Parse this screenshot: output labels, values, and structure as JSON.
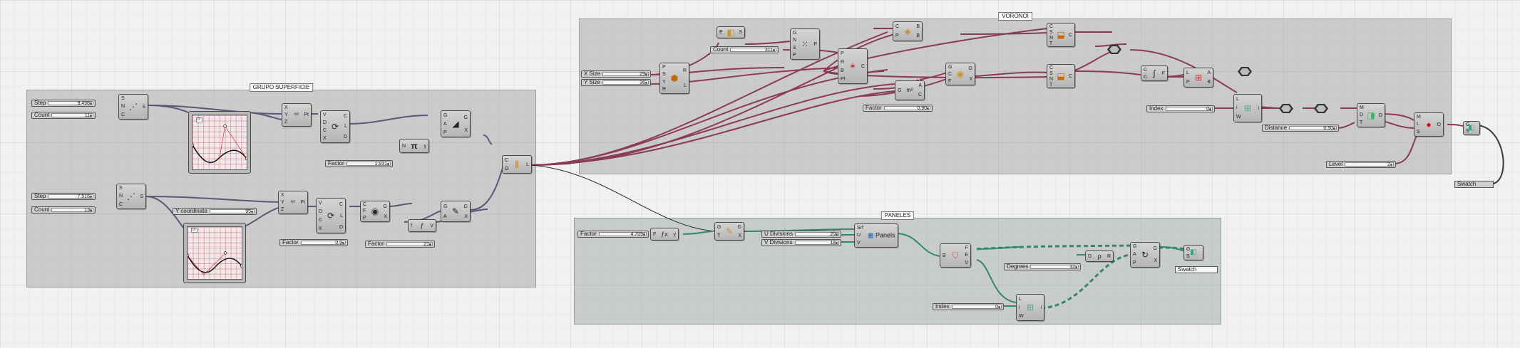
{
  "groups": {
    "superficie": "GRUPO SUPERFICIE",
    "voronoi": "VORONOI",
    "paneles": "PANELES"
  },
  "sliders": {
    "step1": {
      "label": "Step",
      "value": "9.498"
    },
    "count1": {
      "label": "Count",
      "value": "11"
    },
    "step2": {
      "label": "Step",
      "value": "7.516"
    },
    "count2": {
      "label": "Count",
      "value": "13"
    },
    "ycoord": {
      "label": "Y coordinate",
      "value": "95"
    },
    "factor_pi": {
      "label": "Factor",
      "value": "1.931"
    },
    "factor_c": {
      "label": "Factor",
      "value": "0.9"
    },
    "factor_21": {
      "label": "Factor",
      "value": "21"
    },
    "xsize": {
      "label": "X Size",
      "value": "29"
    },
    "ysize": {
      "label": "Y Size",
      "value": "36"
    },
    "count_pop": {
      "label": "Count",
      "value": "311"
    },
    "factor_v": {
      "label": "Factor",
      "value": "0.90"
    },
    "index_v": {
      "label": "Index",
      "value": "0"
    },
    "distance": {
      "label": "Distance",
      "value": "0.50"
    },
    "level": {
      "label": "Level",
      "value": "2"
    },
    "factor_p": {
      "label": "Factor",
      "value": "4.709"
    },
    "udiv": {
      "label": "U Divisions",
      "value": "20"
    },
    "vdiv": {
      "label": "V Divisions",
      "value": "18"
    },
    "degrees": {
      "label": "Degrees",
      "value": "32"
    },
    "index_p": {
      "label": "Index",
      "value": "0"
    }
  },
  "swatch": {
    "label": "Swatch"
  },
  "panels_comp": {
    "name": "Panels"
  },
  "colors": {
    "wire_default": "#5a5878",
    "wire_voronoi": "#8a3a55",
    "wire_panels": "#2f8a6a"
  },
  "icons": [
    "series-icon",
    "graph-mapper-icon",
    "construct-point-icon",
    "evaluate-surface-icon",
    "pi-icon",
    "surface-from-points-icon",
    "voronoi-icon",
    "populate-icon",
    "join-curves-icon",
    "offset-icon",
    "weaverbird-icon",
    "mesh-icon",
    "list-item-icon",
    "custom-preview-icon",
    "divide-domain-icon",
    "panels-icon",
    "explode-icon",
    "rotate-icon"
  ]
}
